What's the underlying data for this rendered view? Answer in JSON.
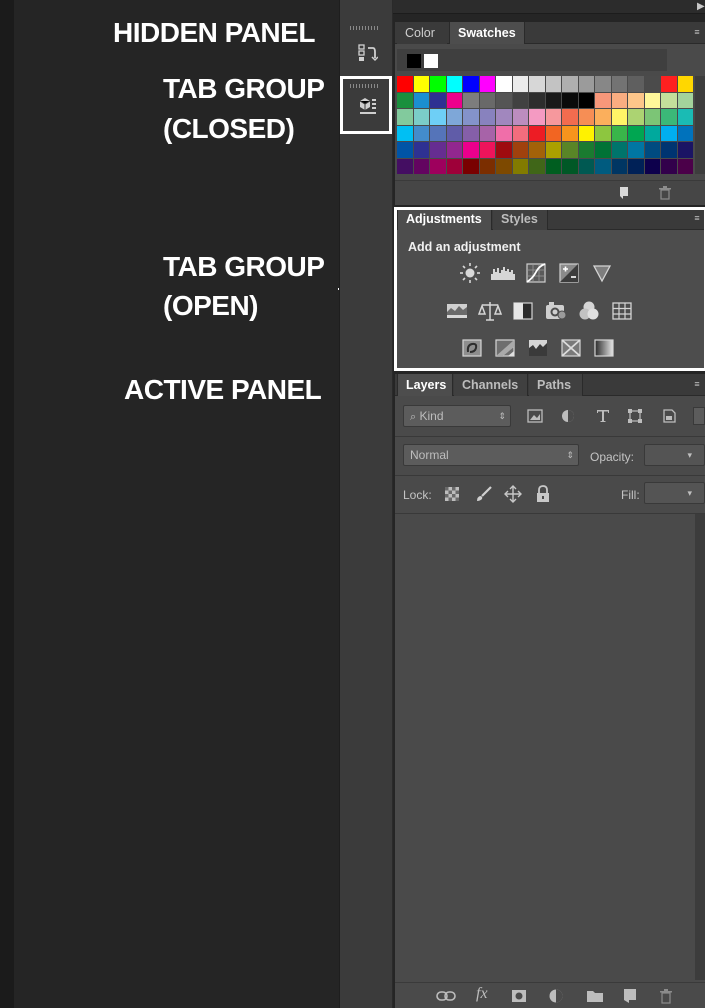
{
  "annotations": {
    "hidden_panel": "HIDDEN PANEL",
    "tab_group_closed_line1": "TAB GROUP",
    "tab_group_closed_line2": "(CLOSED)",
    "tab_group_open_line1": "TAB GROUP",
    "tab_group_open_line2": "(OPEN)",
    "active_panel": "ACTIVE PANEL"
  },
  "dock": {
    "collapse_left": "◀◀",
    "collapse_right": "▶",
    "icons": [
      "history-icon",
      "properties-icon"
    ]
  },
  "color_swatches_panel": {
    "tabs": [
      {
        "label": "Color",
        "active": false
      },
      {
        "label": "Swatches",
        "active": true
      }
    ],
    "foreground_color": "#000000",
    "background_color": "#ffffff",
    "swatch_rows": [
      [
        "#ff0000",
        "#ffff00",
        "#00ff00",
        "#00ffff",
        "#0000ff",
        "#ff00ff",
        "#ffffff",
        "#ebebeb",
        "#d7d7d7",
        "#c3c3c3",
        "#afafaf",
        "#9b9b9b",
        "#878787",
        "#737373",
        "#5f5f5f",
        "#4b4b4b",
        "#ff2020",
        "#ffd700"
      ],
      [
        "#1a8f3d",
        "#1b8fd0",
        "#2e3192",
        "#ec008c",
        "#7d7d7d",
        "#696969",
        "#555555",
        "#414141",
        "#2d2d2d",
        "#191919",
        "#0a0a0a",
        "#000000",
        "#f7977a",
        "#f9ad81",
        "#fdc68a",
        "#fff79a",
        "#c4df9b",
        "#a3d39c"
      ],
      [
        "#82ca9d",
        "#7bcdc8",
        "#6ecff6",
        "#7ea7d8",
        "#8493ca",
        "#8882be",
        "#a187be",
        "#bc8dbf",
        "#f49ac2",
        "#f6989d",
        "#f26c4f",
        "#f68e55",
        "#fbaf5c",
        "#fff467",
        "#acd372",
        "#7cc576",
        "#3bb878",
        "#1abbb4"
      ],
      [
        "#00bff3",
        "#438ccb",
        "#5574b9",
        "#605ca8",
        "#855fa8",
        "#a763a8",
        "#f06ea9",
        "#f26d7d",
        "#ed1c24",
        "#f26522",
        "#f7941d",
        "#fff200",
        "#8dc63f",
        "#39b54a",
        "#00a651",
        "#00a99d",
        "#00aeef",
        "#0072bc"
      ],
      [
        "#0054a6",
        "#2e3192",
        "#662d91",
        "#92278f",
        "#ec008c",
        "#ed145b",
        "#9e0b0f",
        "#a0410d",
        "#a36209",
        "#aba000",
        "#598527",
        "#1a7b30",
        "#007236",
        "#00746b",
        "#0076a3",
        "#004b80",
        "#003471",
        "#1b1464"
      ],
      [
        "#440e62",
        "#630460",
        "#9e005d",
        "#9e0039",
        "#790000",
        "#7b2e00",
        "#7d4900",
        "#827b00",
        "#406618",
        "#005e20",
        "#005826",
        "#005952",
        "#005b7f",
        "#003663",
        "#002157",
        "#0d004c",
        "#32004b",
        "#4b0049"
      ]
    ],
    "footer_icons": [
      "new-swatch-icon",
      "delete-icon"
    ]
  },
  "adjustments_panel": {
    "tabs": [
      {
        "label": "Adjustments",
        "active": true
      },
      {
        "label": "Styles",
        "active": false
      }
    ],
    "title": "Add an adjustment",
    "row1": [
      "brightness-contrast-icon",
      "levels-icon",
      "curves-icon",
      "exposure-icon",
      "vibrance-icon"
    ],
    "row2": [
      "hue-saturation-icon",
      "color-balance-icon",
      "black-white-icon",
      "photo-filter-icon",
      "channel-mixer-icon",
      "color-lookup-icon"
    ],
    "row3": [
      "invert-icon",
      "posterize-icon",
      "threshold-icon",
      "selective-color-icon",
      "gradient-map-icon"
    ]
  },
  "layers_panel": {
    "tabs": [
      {
        "label": "Layers",
        "active": true
      },
      {
        "label": "Channels",
        "active": false
      },
      {
        "label": "Paths",
        "active": false
      }
    ],
    "filter_kind": "Kind",
    "blend_mode": "Normal",
    "opacity_label": "Opacity:",
    "opacity_value": "",
    "lock_label": "Lock:",
    "fill_label": "Fill:",
    "fill_value": "",
    "filter_icons": [
      "pixel-filter-icon",
      "adjustment-filter-icon",
      "type-filter-icon",
      "shape-filter-icon",
      "smart-object-filter-icon"
    ],
    "lock_icons": [
      "lock-transparent-icon",
      "lock-pixels-icon",
      "lock-position-icon",
      "lock-all-icon"
    ],
    "footer_icons": [
      "link-layers-icon",
      "fx-icon",
      "add-mask-icon",
      "new-adjustment-icon",
      "new-group-icon",
      "new-layer-icon",
      "delete-layer-icon"
    ],
    "fx_text": "fx"
  }
}
